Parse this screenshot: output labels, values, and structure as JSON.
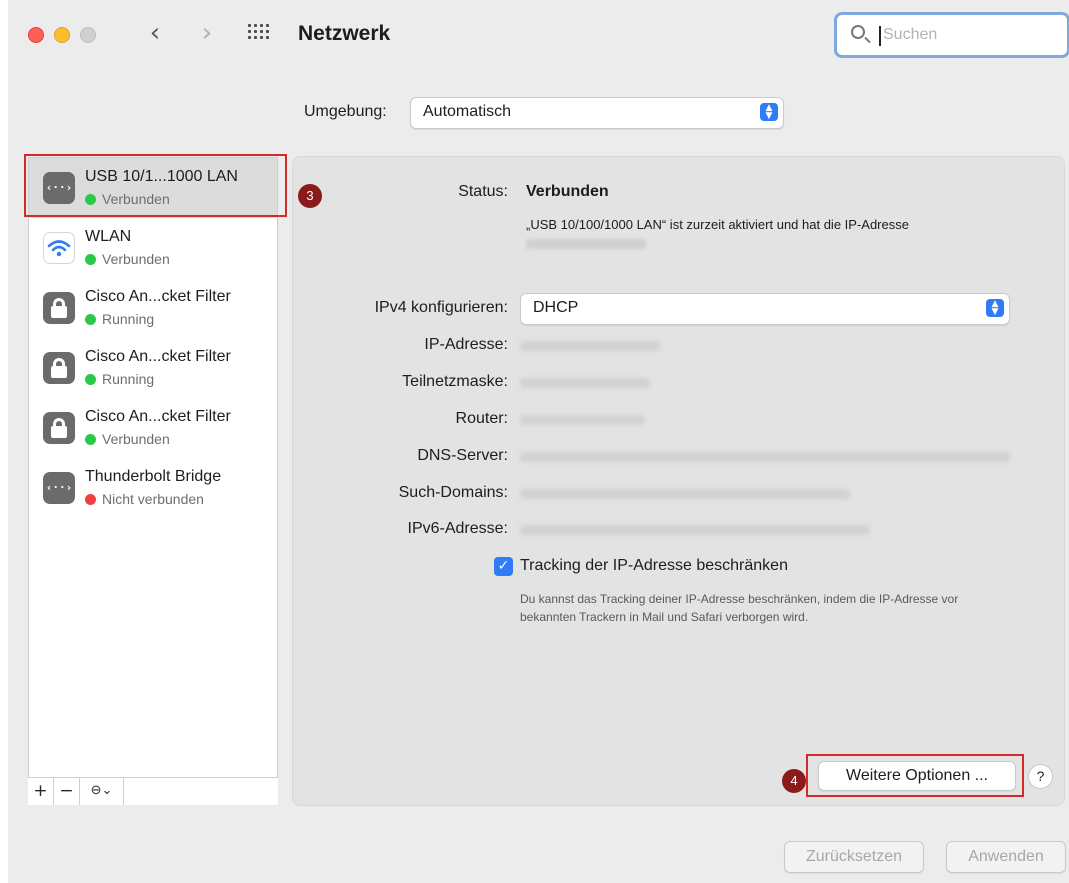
{
  "window": {
    "title": "Netzwerk",
    "search_placeholder": "Suchen",
    "back_glyph": "‹",
    "forward_glyph": "›"
  },
  "location": {
    "label": "Umgebung:",
    "value": "Automatisch"
  },
  "services": [
    {
      "name": "USB 10/1...1000 LAN",
      "status": "Verbunden",
      "status_color": "green",
      "icon": "ethernet-icon",
      "selected": true
    },
    {
      "name": "WLAN",
      "status": "Verbunden",
      "status_color": "green",
      "icon": "wifi-icon",
      "selected": false
    },
    {
      "name": "Cisco An...cket Filter",
      "status": "Running",
      "status_color": "green",
      "icon": "lock-icon",
      "selected": false
    },
    {
      "name": "Cisco An...cket Filter",
      "status": "Running",
      "status_color": "green",
      "icon": "lock-icon",
      "selected": false
    },
    {
      "name": "Cisco An...cket Filter",
      "status": "Verbunden",
      "status_color": "green",
      "icon": "lock-icon",
      "selected": false
    },
    {
      "name": "Thunderbolt Bridge",
      "status": "Nicht verbunden",
      "status_color": "red",
      "icon": "ethernet-icon",
      "selected": false
    }
  ],
  "sidebar_toolbar": {
    "add": "+",
    "remove": "−",
    "more": "⊖⌄"
  },
  "detail": {
    "status_label": "Status:",
    "status_value": "Verbunden",
    "status_description": "„USB 10/100/1000 LAN“ ist zurzeit aktiviert und hat die IP-Adresse",
    "ipv4_label": "IPv4 konfigurieren:",
    "ipv4_value": "DHCP",
    "ip_label": "IP-Adresse:",
    "mask_label": "Teilnetzmaske:",
    "router_label": "Router:",
    "dns_label": "DNS-Server:",
    "domains_label": "Such-Domains:",
    "ipv6_label": "IPv6-Adresse:",
    "tracking_checked": true,
    "tracking_label": "Tracking der IP-Adresse beschränken",
    "tracking_description": "Du kannst das Tracking deiner IP-Adresse beschränken, indem die IP-Adresse vor bekannten Trackern in Mail und Safari verborgen wird.",
    "more_options_button": "Weitere Optionen ...",
    "help_button": "?"
  },
  "footer": {
    "reset_button": "Zurücksetzen",
    "apply_button": "Anwenden"
  },
  "annotations": {
    "badge_3": "3",
    "badge_4": "4"
  },
  "colors": {
    "accent": "#2e7cf6",
    "highlight": "#d42a2a",
    "badge": "#8b1a1a",
    "status_green": "#2cc84a",
    "status_red": "#ee4040"
  }
}
